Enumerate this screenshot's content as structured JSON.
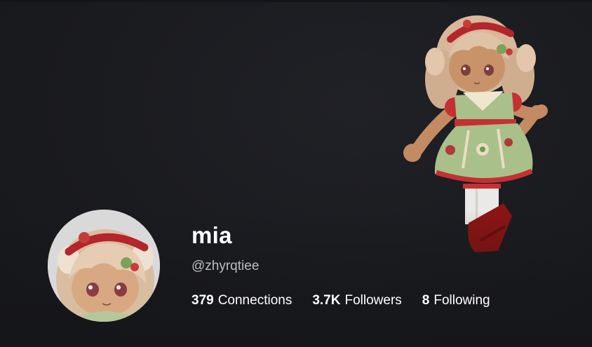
{
  "profile": {
    "display_name": "mia",
    "username": "@zhyrqtiee",
    "stats": [
      {
        "count": "379",
        "label": "Connections"
      },
      {
        "count": "3.7K",
        "label": "Followers"
      },
      {
        "count": "8",
        "label": "Following"
      }
    ]
  },
  "theme": {
    "background": "#1b1c20",
    "text_primary": "#ffffff",
    "text_secondary": "#bdbec3",
    "headshot_bg": "#d9d9d9"
  }
}
